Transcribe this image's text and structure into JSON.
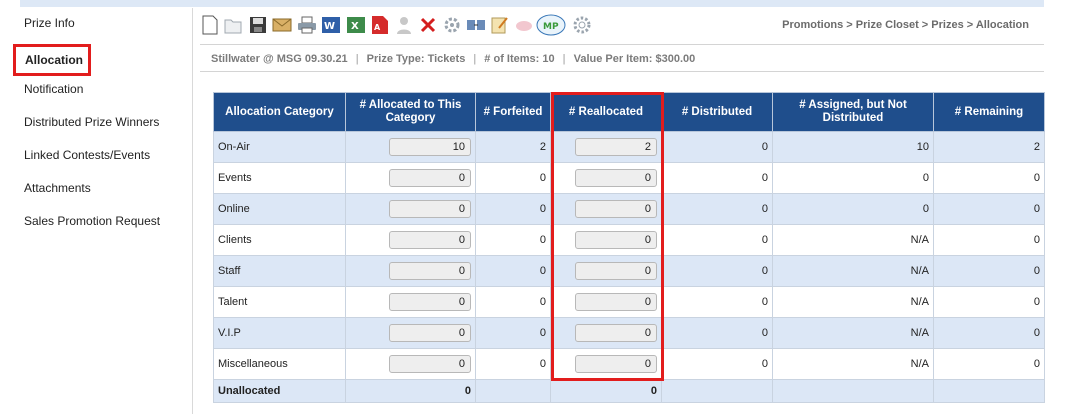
{
  "sidebar": {
    "items": [
      {
        "label": "Prize Info"
      },
      {
        "label": "Allocation"
      },
      {
        "label": "Notification"
      },
      {
        "label": "Distributed Prize Winners"
      },
      {
        "label": "Linked Contests/Events"
      },
      {
        "label": "Attachments"
      },
      {
        "label": "Sales Promotion Request"
      }
    ]
  },
  "toolbar": {
    "icons": [
      "new-document-icon",
      "open-folder-icon",
      "save-icon",
      "email-icon",
      "print-icon",
      "word-export-icon",
      "excel-export-icon",
      "pdf-export-icon",
      "user-icon",
      "delete-icon",
      "settings-icon",
      "transfer-icon",
      "edit-icon",
      "link-icon",
      "logo-badge-icon",
      "gear-icon"
    ]
  },
  "breadcrumb": "Promotions > Prize Closet > Prizes > Allocation",
  "info": {
    "event": "Stillwater @ MSG 09.30.21",
    "prize_type": "Prize Type: Tickets",
    "items": "# of Items: 10",
    "value": "Value Per Item: $300.00",
    "separator": "|"
  },
  "table": {
    "headers": [
      "Allocation Category",
      "# Allocated to This Category",
      "# Forfeited",
      "# Reallocated",
      "# Distributed",
      "# Assigned, but Not Distributed",
      "# Remaining"
    ],
    "rows": [
      {
        "category": "On-Air",
        "allocated": "10",
        "forfeited": "2",
        "reallocated": "2",
        "distributed": "0",
        "assigned": "10",
        "remaining": "2"
      },
      {
        "category": "Events",
        "allocated": "0",
        "forfeited": "0",
        "reallocated": "0",
        "distributed": "0",
        "assigned": "0",
        "remaining": "0"
      },
      {
        "category": "Online",
        "allocated": "0",
        "forfeited": "0",
        "reallocated": "0",
        "distributed": "0",
        "assigned": "0",
        "remaining": "0"
      },
      {
        "category": "Clients",
        "allocated": "0",
        "forfeited": "0",
        "reallocated": "0",
        "distributed": "0",
        "assigned": "N/A",
        "remaining": "0"
      },
      {
        "category": "Staff",
        "allocated": "0",
        "forfeited": "0",
        "reallocated": "0",
        "distributed": "0",
        "assigned": "N/A",
        "remaining": "0"
      },
      {
        "category": "Talent",
        "allocated": "0",
        "forfeited": "0",
        "reallocated": "0",
        "distributed": "0",
        "assigned": "N/A",
        "remaining": "0"
      },
      {
        "category": "V.I.P",
        "allocated": "0",
        "forfeited": "0",
        "reallocated": "0",
        "distributed": "0",
        "assigned": "N/A",
        "remaining": "0"
      },
      {
        "category": "Miscellaneous",
        "allocated": "0",
        "forfeited": "0",
        "reallocated": "0",
        "distributed": "0",
        "assigned": "N/A",
        "remaining": "0"
      }
    ],
    "unallocated": {
      "label": "Unallocated",
      "allocated": "0",
      "reallocated": "0"
    }
  },
  "colors": {
    "header_bg": "#1f4e8c",
    "alt_row": "#dce7f6",
    "highlight": "#e21d1d"
  }
}
